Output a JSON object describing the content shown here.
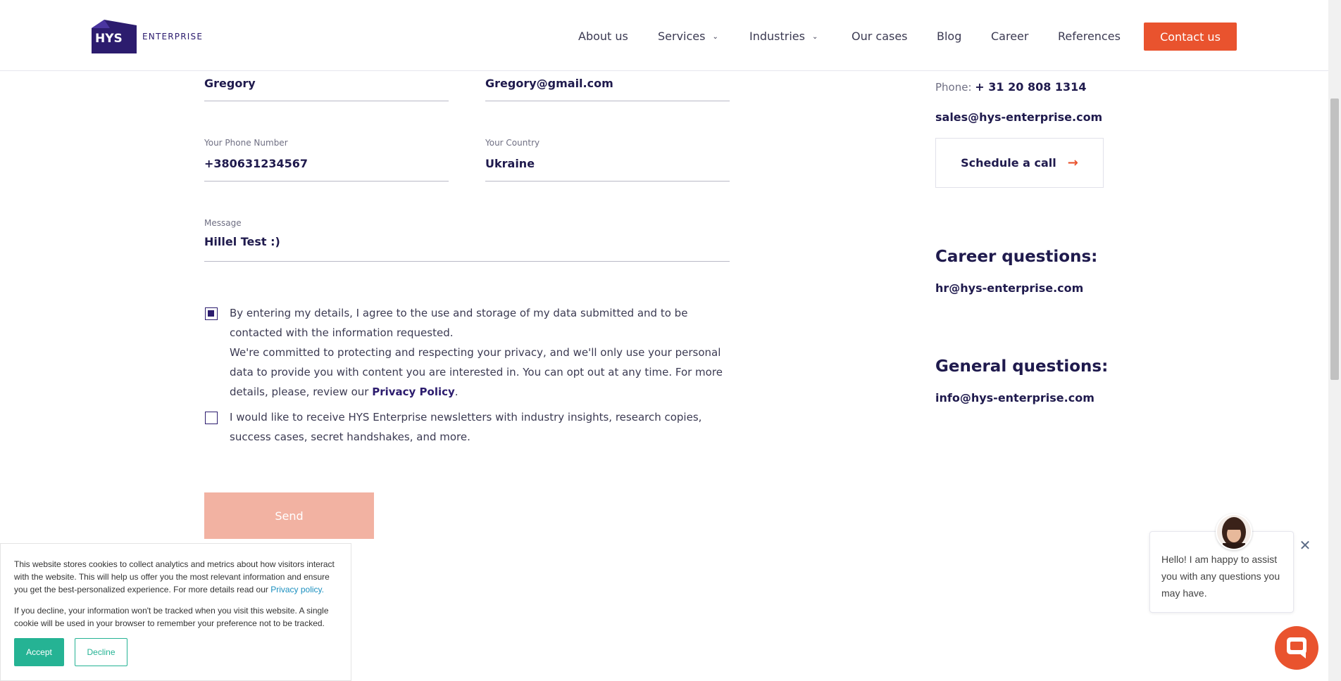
{
  "header": {
    "logo_mark_text": "HYS",
    "logo_word": "ENTERPRISE",
    "nav": [
      {
        "label": "About us"
      },
      {
        "label": "Services"
      },
      {
        "label": "Industries"
      },
      {
        "label": "Our cases"
      },
      {
        "label": "Blog"
      },
      {
        "label": "Career"
      },
      {
        "label": "References"
      }
    ],
    "contact_label": "Contact us"
  },
  "form": {
    "name_value": "Gregory",
    "email_value": "Gregory@gmail.com",
    "phone_label": "Your Phone Number",
    "phone_value": "+380631234567",
    "country_label": "Your Country",
    "country_value": "Ukraine",
    "message_label": "Message",
    "message_value": "Hillel Test :)",
    "consent_text_1": "By entering my details, I agree to the use and storage of my data submitted and to be contacted with the information requested.",
    "consent_text_2": "We're committed to protecting and respecting your privacy, and we'll only use your personal data to provide you with content you are interested in. You can opt out at any time. For more details, please, review our ",
    "privacy_link": "Privacy Policy",
    "consent_end": ".",
    "newsletter_text": "I would like to receive HYS Enterprise newsletters with industry insights, research copies, success cases, secret handshakes, and more.",
    "consent_checked": true,
    "newsletter_checked": false,
    "send_label": "Send"
  },
  "contacts": {
    "phone_prefix": "Phone: ",
    "phone_value": "+ 31 20 808 1314",
    "sales_email": "sales@hys-enterprise.com",
    "schedule_label": "Schedule a call",
    "career_heading": "Career questions:",
    "hr_email": "hr@hys-enterprise.com",
    "general_heading": "General questions:",
    "info_email": "info@hys-enterprise.com"
  },
  "cookie": {
    "text_1": "This website stores cookies to collect analytics and metrics about how visitors interact with the website. This will help us offer you the most relevant information and ensure you get the best-personalized experience. For more details read our ",
    "privacy_link": "Privacy policy.",
    "text_2": "If you decline, your information won't be tracked when you visit this website. A single cookie will be used in your browser to remember your preference not to be tracked.",
    "accept_label": "Accept",
    "decline_label": "Decline"
  },
  "chat": {
    "message": "Hello! I am happy to assist you with any questions you may have."
  },
  "colors": {
    "brand_navy": "#2c1c6e",
    "accent_orange": "#e9532e",
    "cookie_green": "#25b394"
  }
}
